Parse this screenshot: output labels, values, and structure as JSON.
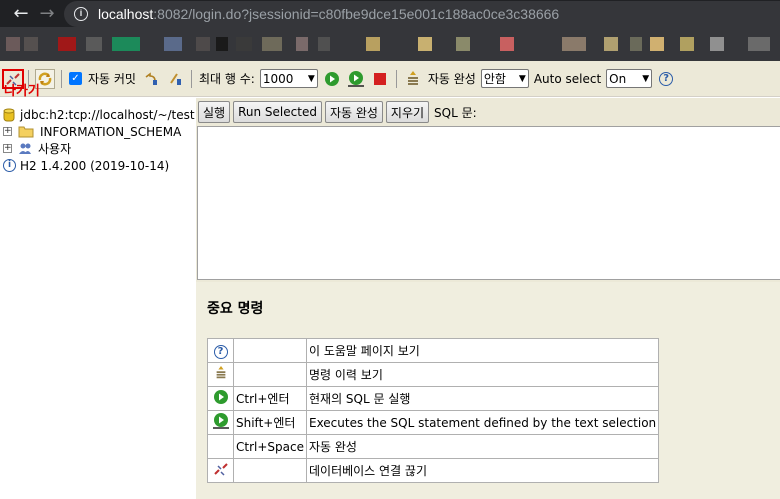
{
  "browser": {
    "url_host": "localhost",
    "url_rest": ":8082/login.do?jsessionid=c80fbe9dce15e001c188ac0ce3c38666"
  },
  "toolbar": {
    "disconnect_label": "나가기",
    "autocommit_label": "자동 커밋",
    "max_rows_label": "최대 행 수:",
    "max_rows_value": "1000",
    "autocomplete_label": "자동 완성",
    "autocomplete_value": "안함",
    "autoselect_label": "Auto select",
    "autoselect_value": "On"
  },
  "tree": {
    "connection": "jdbc:h2:tcp://localhost/~/test",
    "info_schema": "INFORMATION_SCHEMA",
    "users": "사용자",
    "version": "H2 1.4.200 (2019-10-14)"
  },
  "sqlbar": {
    "run": "실행",
    "run_selected": "Run Selected",
    "auto_complete": "자동 완성",
    "clear": "지우기",
    "sql_label": "SQL 문:"
  },
  "help": {
    "title": "중요 명령",
    "rows": [
      {
        "icon": "help-icon",
        "key": "",
        "desc": "이 도움말 페이지 보기"
      },
      {
        "icon": "history-icon",
        "key": "",
        "desc": "명령 이력 보기"
      },
      {
        "icon": "run-icon",
        "key": "Ctrl+엔터",
        "desc": "현재의 SQL 문 실행"
      },
      {
        "icon": "run-selected-icon",
        "key": "Shift+엔터",
        "desc": "Executes the SQL statement defined by the text selection"
      },
      {
        "icon": "",
        "key": "Ctrl+Space",
        "desc": "자동 완성"
      },
      {
        "icon": "disconnect-icon",
        "key": "",
        "desc": "데이터베이스 연결 끊기"
      }
    ]
  },
  "colors": {
    "toolbar_bg": "#ece9d8",
    "highlight_red": "#e00000",
    "run_green": "#2e9b2e",
    "stop_red": "#d42020"
  }
}
